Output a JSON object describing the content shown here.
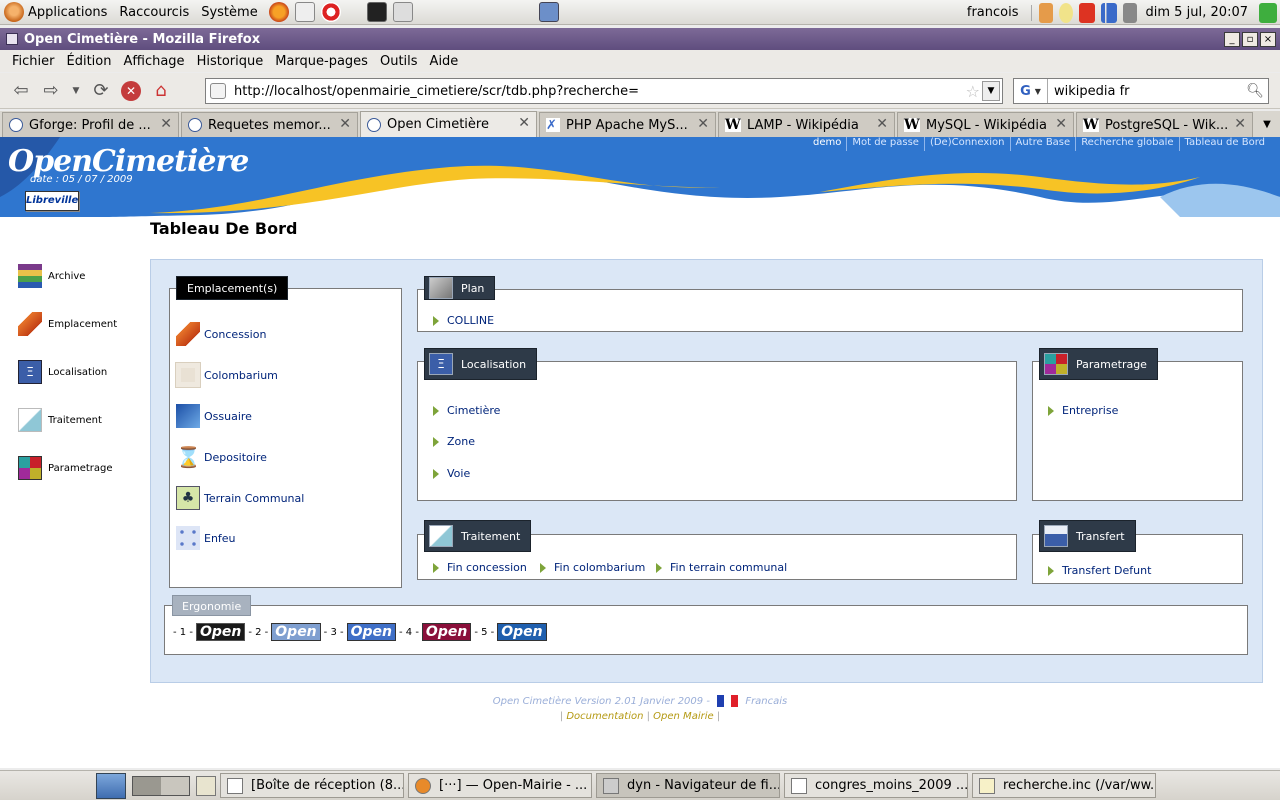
{
  "panel": {
    "menus": [
      "Applications",
      "Raccourcis",
      "Système"
    ],
    "user": "francois",
    "clock": "dim  5 juI, 20:07"
  },
  "window": {
    "title": "Open Cimetière - Mozilla Firefox"
  },
  "menubar": [
    "Fichier",
    "Édition",
    "Affichage",
    "Historique",
    "Marque-pages",
    "Outils",
    "Aide"
  ],
  "navbar": {
    "url": "http://localhost/openmairie_cimetiere/scr/tdb.php?recherche=",
    "search_engine": "G",
    "search_value": "wikipedia fr"
  },
  "tabs": [
    {
      "label": "Gforge: Profil de ...",
      "icon": "globe"
    },
    {
      "label": "Requetes memor...",
      "icon": "globe"
    },
    {
      "label": "Open Cimetière",
      "icon": "globe",
      "active": true
    },
    {
      "label": "PHP Apache MyS...",
      "icon": "tools"
    },
    {
      "label": "LAMP - Wikipédia",
      "icon": "W"
    },
    {
      "label": "MySQL - Wikipédia",
      "icon": "W"
    },
    {
      "label": "PostgreSQL - Wik...",
      "icon": "W"
    }
  ],
  "site": {
    "top_links": {
      "user": "demo",
      "items": [
        "Mot de passe",
        "(De)Connexion",
        "Autre Base",
        "Recherche globale",
        "Tableau de Bord"
      ]
    },
    "logo": "OpenCimetière",
    "date": "date : 05 / 07 / 2009",
    "city": "Libreville",
    "left_nav": [
      "Archive",
      "Emplacement",
      "Localisation",
      "Traitement",
      "Parametrage"
    ],
    "page_title": "Tableau De Bord",
    "emplacement": {
      "title": "Emplacement(s)",
      "items": [
        "Concession",
        "Colombarium",
        "Ossuaire",
        "Depositoire",
        "Terrain Communal",
        "Enfeu"
      ]
    },
    "plan": {
      "title": "Plan",
      "items": [
        "COLLINE"
      ]
    },
    "localisation": {
      "title": "Localisation",
      "items": [
        "Cimetière",
        "Zone",
        "Voie"
      ]
    },
    "parametrage": {
      "title": "Parametrage",
      "items": [
        "Entreprise"
      ]
    },
    "traitement": {
      "title": "Traitement",
      "items": [
        "Fin concession",
        "Fin colombarium",
        "Fin terrain communal"
      ]
    },
    "transfert": {
      "title": "Transfert",
      "items": [
        "Transfert  Defunt"
      ]
    },
    "ergonomie": {
      "title": "Ergonomie",
      "options": [
        {
          "num": "- 1 -",
          "label": "Open",
          "bg": "#1a1a1a"
        },
        {
          "num": "- 2 -",
          "label": "Open",
          "bg": "#7f9fd0"
        },
        {
          "num": "- 3 -",
          "label": "Open",
          "bg": "#3f6fc7"
        },
        {
          "num": "- 4 -",
          "label": "Open",
          "bg": "#8a0f3a"
        },
        {
          "num": "- 5 -",
          "label": "Open",
          "bg": "#1f5fae"
        }
      ]
    },
    "footer": {
      "line1": "Open Cimetière  Version 2.01 Janvier 2009 -",
      "lang": "Francais",
      "doc": "Documentation",
      "mairie": "Open Mairie"
    }
  },
  "taskbar": [
    "[Boîte de réception (8...",
    "[···] — Open-Mairie - ...",
    "dyn - Navigateur de fi...",
    "congres_moins_2009 ...",
    "recherche.inc (/var/ww..."
  ]
}
